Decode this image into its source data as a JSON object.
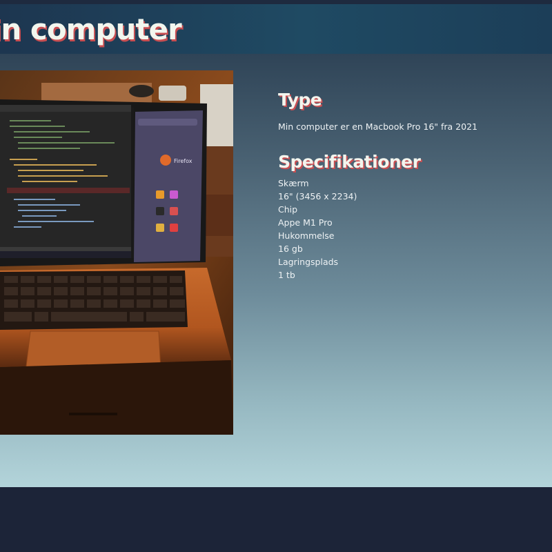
{
  "header": {
    "title": "in computer"
  },
  "photo": {
    "firefox_label": "Firefox"
  },
  "type_section": {
    "heading": "Type",
    "description": "Min computer er en Macbook Pro 16\" fra 2021"
  },
  "specs_section": {
    "heading": "Specifikationer",
    "items": [
      "Skærm",
      "16\" (3456 x 2234)",
      "Chip",
      "Appe M1 Pro",
      "Hukommelse",
      "16 gb",
      "Lagringsplads",
      "1 tb"
    ]
  }
}
